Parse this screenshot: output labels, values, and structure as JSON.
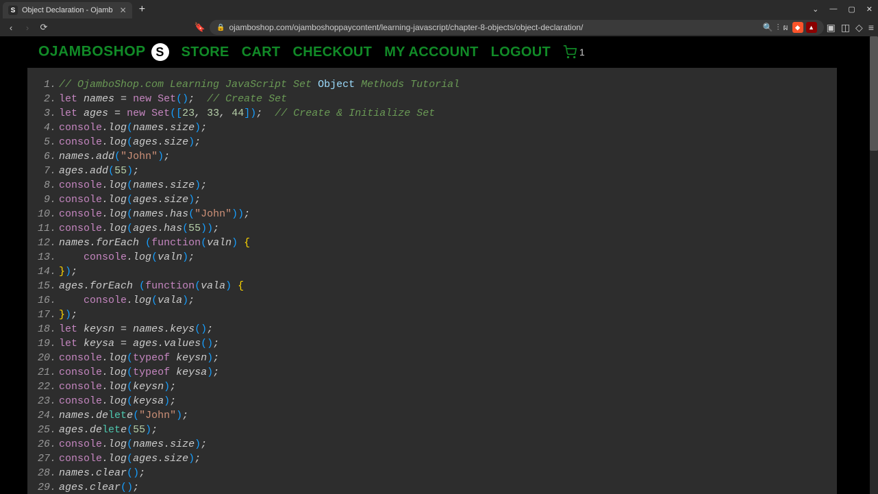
{
  "browser": {
    "tab_title": "Object Declaration - Ojamb",
    "tab_favicon_letter": "S",
    "url": "ojamboshop.com/ojamboshoppaycontent/learning-javascript/chapter-8-objects/object-declaration/"
  },
  "nav": {
    "brand": "OJAMBOSHOP",
    "brand_logo_letter": "S",
    "links": [
      "STORE",
      "CART",
      "CHECKOUT",
      "MY ACCOUNT",
      "LOGOUT"
    ],
    "cart_count": "1"
  },
  "code": {
    "lines": [
      [
        [
          "comment",
          "// OjamboShop.com Learning JavaScript Set "
        ],
        [
          "object",
          "Object"
        ],
        [
          "comment",
          " Methods Tutorial"
        ]
      ],
      [
        [
          "keyword",
          "let"
        ],
        [
          "plain",
          " "
        ],
        [
          "ident",
          "names "
        ],
        [
          "punct",
          "= "
        ],
        [
          "keyword",
          "new"
        ],
        [
          "plain",
          " "
        ],
        [
          "type",
          "Set"
        ],
        [
          "paren",
          "("
        ],
        [
          "paren",
          ")"
        ],
        [
          "punct",
          ";  "
        ],
        [
          "comment",
          "// Create Set"
        ]
      ],
      [
        [
          "keyword",
          "let"
        ],
        [
          "plain",
          " "
        ],
        [
          "ident",
          "ages "
        ],
        [
          "punct",
          "= "
        ],
        [
          "keyword",
          "new"
        ],
        [
          "plain",
          " "
        ],
        [
          "type",
          "Set"
        ],
        [
          "paren",
          "("
        ],
        [
          "bracket",
          "["
        ],
        [
          "num",
          "23"
        ],
        [
          "punct",
          ", "
        ],
        [
          "num",
          "33"
        ],
        [
          "punct",
          ", "
        ],
        [
          "num",
          "44"
        ],
        [
          "bracket",
          "]"
        ],
        [
          "paren",
          ")"
        ],
        [
          "punct",
          ";  "
        ],
        [
          "comment",
          "// Create & Initialize Set"
        ]
      ],
      [
        [
          "console",
          "console"
        ],
        [
          "punct",
          "."
        ],
        [
          "method",
          "log"
        ],
        [
          "paren",
          "("
        ],
        [
          "ident",
          "names"
        ],
        [
          "punct",
          "."
        ],
        [
          "ident",
          "size"
        ],
        [
          "paren",
          ")"
        ],
        [
          "punct",
          ";"
        ]
      ],
      [
        [
          "console",
          "console"
        ],
        [
          "punct",
          "."
        ],
        [
          "method",
          "log"
        ],
        [
          "paren",
          "("
        ],
        [
          "ident",
          "ages"
        ],
        [
          "punct",
          "."
        ],
        [
          "ident",
          "size"
        ],
        [
          "paren",
          ")"
        ],
        [
          "punct",
          ";"
        ]
      ],
      [
        [
          "ident",
          "names"
        ],
        [
          "punct",
          "."
        ],
        [
          "method",
          "add"
        ],
        [
          "paren",
          "("
        ],
        [
          "str",
          "\"John\""
        ],
        [
          "paren",
          ")"
        ],
        [
          "punct",
          ";"
        ]
      ],
      [
        [
          "ident",
          "ages"
        ],
        [
          "punct",
          "."
        ],
        [
          "method",
          "add"
        ],
        [
          "paren",
          "("
        ],
        [
          "num",
          "55"
        ],
        [
          "paren",
          ")"
        ],
        [
          "punct",
          ";"
        ]
      ],
      [
        [
          "console",
          "console"
        ],
        [
          "punct",
          "."
        ],
        [
          "method",
          "log"
        ],
        [
          "paren",
          "("
        ],
        [
          "ident",
          "names"
        ],
        [
          "punct",
          "."
        ],
        [
          "ident",
          "size"
        ],
        [
          "paren",
          ")"
        ],
        [
          "punct",
          ";"
        ]
      ],
      [
        [
          "console",
          "console"
        ],
        [
          "punct",
          "."
        ],
        [
          "method",
          "log"
        ],
        [
          "paren",
          "("
        ],
        [
          "ident",
          "ages"
        ],
        [
          "punct",
          "."
        ],
        [
          "ident",
          "size"
        ],
        [
          "paren",
          ")"
        ],
        [
          "punct",
          ";"
        ]
      ],
      [
        [
          "console",
          "console"
        ],
        [
          "punct",
          "."
        ],
        [
          "method",
          "log"
        ],
        [
          "paren",
          "("
        ],
        [
          "ident",
          "names"
        ],
        [
          "punct",
          "."
        ],
        [
          "method",
          "has"
        ],
        [
          "paren",
          "("
        ],
        [
          "str",
          "\"John\""
        ],
        [
          "paren",
          ")"
        ],
        [
          "paren",
          ")"
        ],
        [
          "punct",
          ";"
        ]
      ],
      [
        [
          "console",
          "console"
        ],
        [
          "punct",
          "."
        ],
        [
          "method",
          "log"
        ],
        [
          "paren",
          "("
        ],
        [
          "ident",
          "ages"
        ],
        [
          "punct",
          "."
        ],
        [
          "method",
          "has"
        ],
        [
          "paren",
          "("
        ],
        [
          "num",
          "55"
        ],
        [
          "paren",
          ")"
        ],
        [
          "paren",
          ")"
        ],
        [
          "punct",
          ";"
        ]
      ],
      [
        [
          "ident",
          "names"
        ],
        [
          "punct",
          "."
        ],
        [
          "method",
          "forEach "
        ],
        [
          "paren",
          "("
        ],
        [
          "func",
          "function"
        ],
        [
          "paren",
          "("
        ],
        [
          "ident",
          "valn"
        ],
        [
          "paren",
          ")"
        ],
        [
          "plain",
          " "
        ],
        [
          "brace",
          "{"
        ]
      ],
      [
        [
          "plain",
          "    "
        ],
        [
          "console",
          "console"
        ],
        [
          "punct",
          "."
        ],
        [
          "method",
          "log"
        ],
        [
          "paren",
          "("
        ],
        [
          "ident",
          "valn"
        ],
        [
          "paren",
          ")"
        ],
        [
          "punct",
          ";"
        ]
      ],
      [
        [
          "brace",
          "}"
        ],
        [
          "paren",
          ")"
        ],
        [
          "punct",
          ";"
        ]
      ],
      [
        [
          "ident",
          "ages"
        ],
        [
          "punct",
          "."
        ],
        [
          "method",
          "forEach "
        ],
        [
          "paren",
          "("
        ],
        [
          "func",
          "function"
        ],
        [
          "paren",
          "("
        ],
        [
          "ident",
          "vala"
        ],
        [
          "paren",
          ")"
        ],
        [
          "plain",
          " "
        ],
        [
          "brace",
          "{"
        ]
      ],
      [
        [
          "plain",
          "    "
        ],
        [
          "console",
          "console"
        ],
        [
          "punct",
          "."
        ],
        [
          "method",
          "log"
        ],
        [
          "paren",
          "("
        ],
        [
          "ident",
          "vala"
        ],
        [
          "paren",
          ")"
        ],
        [
          "punct",
          ";"
        ]
      ],
      [
        [
          "brace",
          "}"
        ],
        [
          "paren",
          ")"
        ],
        [
          "punct",
          ";"
        ]
      ],
      [
        [
          "keyword",
          "let"
        ],
        [
          "plain",
          " "
        ],
        [
          "ident",
          "keysn "
        ],
        [
          "punct",
          "= "
        ],
        [
          "ident",
          "names"
        ],
        [
          "punct",
          "."
        ],
        [
          "method",
          "keys"
        ],
        [
          "paren",
          "("
        ],
        [
          "paren",
          ")"
        ],
        [
          "punct",
          ";"
        ]
      ],
      [
        [
          "keyword",
          "let"
        ],
        [
          "plain",
          " "
        ],
        [
          "ident",
          "keysa "
        ],
        [
          "punct",
          "= "
        ],
        [
          "ident",
          "ages"
        ],
        [
          "punct",
          "."
        ],
        [
          "method",
          "values"
        ],
        [
          "paren",
          "("
        ],
        [
          "paren",
          ")"
        ],
        [
          "punct",
          ";"
        ]
      ],
      [
        [
          "console",
          "console"
        ],
        [
          "punct",
          "."
        ],
        [
          "method",
          "log"
        ],
        [
          "paren",
          "("
        ],
        [
          "keyword",
          "typeof"
        ],
        [
          "plain",
          " "
        ],
        [
          "ident",
          "keysn"
        ],
        [
          "paren",
          ")"
        ],
        [
          "punct",
          ";"
        ]
      ],
      [
        [
          "console",
          "console"
        ],
        [
          "punct",
          "."
        ],
        [
          "method",
          "log"
        ],
        [
          "paren",
          "("
        ],
        [
          "keyword",
          "typeof"
        ],
        [
          "plain",
          " "
        ],
        [
          "ident",
          "keysa"
        ],
        [
          "paren",
          ")"
        ],
        [
          "punct",
          ";"
        ]
      ],
      [
        [
          "console",
          "console"
        ],
        [
          "punct",
          "."
        ],
        [
          "method",
          "log"
        ],
        [
          "paren",
          "("
        ],
        [
          "ident",
          "keysn"
        ],
        [
          "paren",
          ")"
        ],
        [
          "punct",
          ";"
        ]
      ],
      [
        [
          "console",
          "console"
        ],
        [
          "punct",
          "."
        ],
        [
          "method",
          "log"
        ],
        [
          "paren",
          "("
        ],
        [
          "ident",
          "keysa"
        ],
        [
          "paren",
          ")"
        ],
        [
          "punct",
          ";"
        ]
      ],
      [
        [
          "ident",
          "names"
        ],
        [
          "punct",
          "."
        ],
        [
          "ident",
          "de"
        ],
        [
          "let2",
          "let"
        ],
        [
          "ident",
          "e"
        ],
        [
          "paren",
          "("
        ],
        [
          "str",
          "\"John\""
        ],
        [
          "paren",
          ")"
        ],
        [
          "punct",
          ";"
        ]
      ],
      [
        [
          "ident",
          "ages"
        ],
        [
          "punct",
          "."
        ],
        [
          "ident",
          "de"
        ],
        [
          "let2",
          "let"
        ],
        [
          "ident",
          "e"
        ],
        [
          "paren",
          "("
        ],
        [
          "num",
          "55"
        ],
        [
          "paren",
          ")"
        ],
        [
          "punct",
          ";"
        ]
      ],
      [
        [
          "console",
          "console"
        ],
        [
          "punct",
          "."
        ],
        [
          "method",
          "log"
        ],
        [
          "paren",
          "("
        ],
        [
          "ident",
          "names"
        ],
        [
          "punct",
          "."
        ],
        [
          "ident",
          "size"
        ],
        [
          "paren",
          ")"
        ],
        [
          "punct",
          ";"
        ]
      ],
      [
        [
          "console",
          "console"
        ],
        [
          "punct",
          "."
        ],
        [
          "method",
          "log"
        ],
        [
          "paren",
          "("
        ],
        [
          "ident",
          "ages"
        ],
        [
          "punct",
          "."
        ],
        [
          "ident",
          "size"
        ],
        [
          "paren",
          ")"
        ],
        [
          "punct",
          ";"
        ]
      ],
      [
        [
          "ident",
          "names"
        ],
        [
          "punct",
          "."
        ],
        [
          "method",
          "clear"
        ],
        [
          "paren",
          "("
        ],
        [
          "paren",
          ")"
        ],
        [
          "punct",
          ";"
        ]
      ],
      [
        [
          "ident",
          "ages"
        ],
        [
          "punct",
          "."
        ],
        [
          "method",
          "clear"
        ],
        [
          "paren",
          "("
        ],
        [
          "paren",
          ")"
        ],
        [
          "punct",
          ";"
        ]
      ]
    ]
  }
}
